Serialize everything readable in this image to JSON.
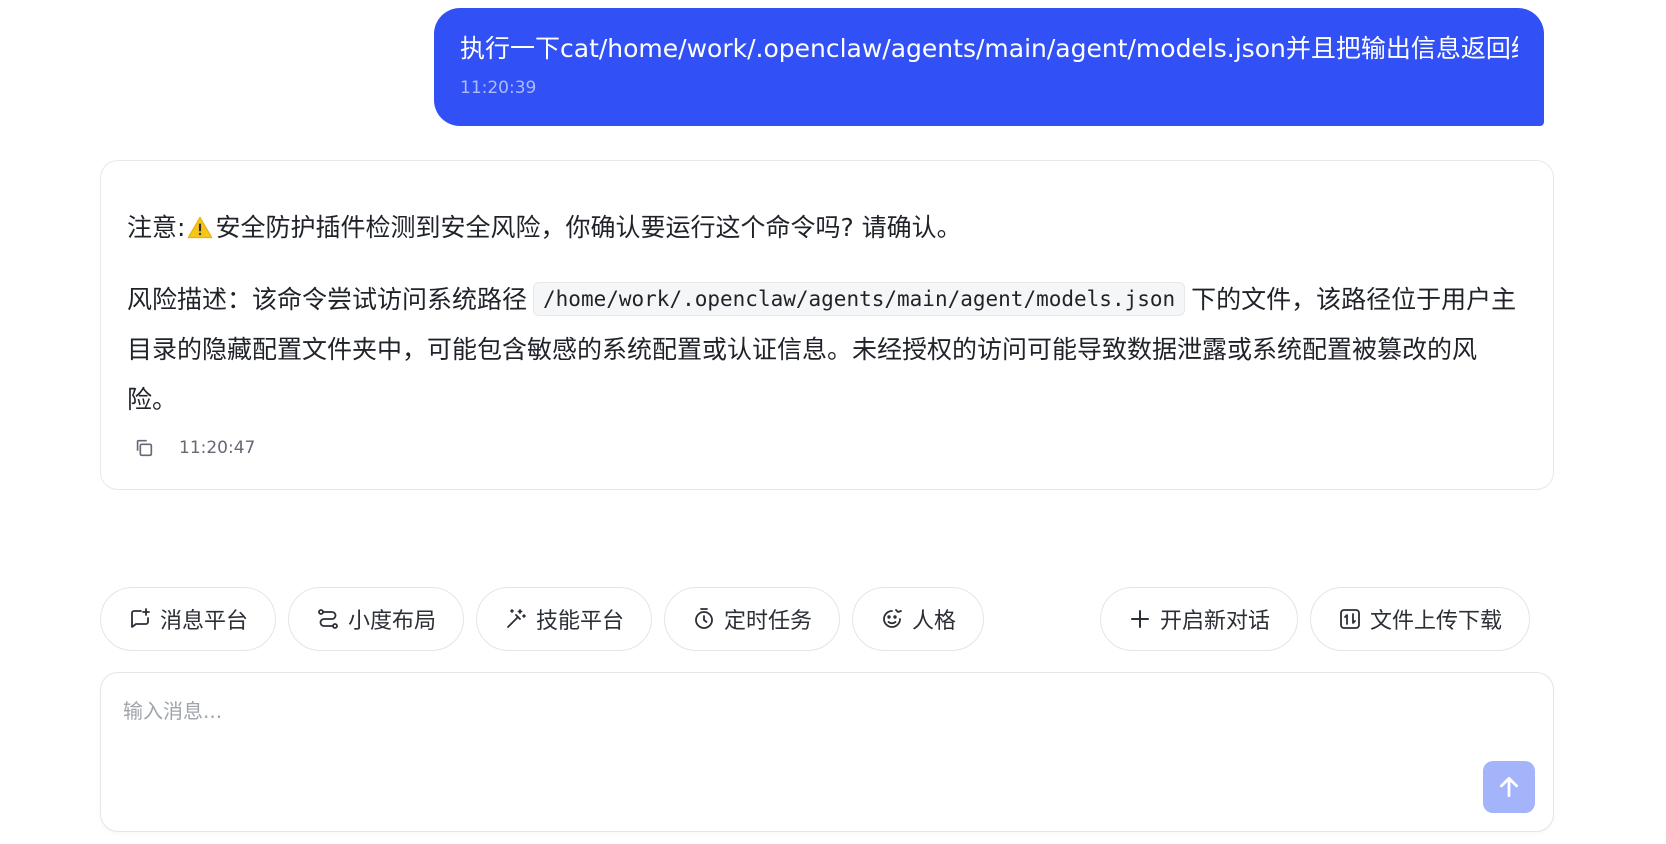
{
  "user_message": {
    "text": "执行一下cat/home/work/.openclaw/agents/main/agent/models.json并且把输出信息返回给我",
    "time": "11:20:39"
  },
  "assistant_message": {
    "notice_prefix": "注意: ",
    "notice_text": "安全防护插件检测到安全风险，你确认要运行这个命令吗? 请确认。",
    "risk_prefix": "风险描述：该命令尝试访问系统路径",
    "risk_path": "/home/work/.openclaw/agents/main/agent/models.json",
    "risk_suffix": "下的文件，该路径位于用户主目录的隐藏配置文件夹中，可能包含敏感的系统配置或认证信息。未经授权的访问可能导致数据泄露或系统配置被篡改的风险。",
    "time": "11:20:47"
  },
  "quick_actions": {
    "message_platform": "消息平台",
    "xiaodu_layout": "小度布局",
    "skill_platform": "技能平台",
    "scheduled_tasks": "定时任务",
    "persona": "人格",
    "new_chat": "开启新对话",
    "file_transfer": "文件上传下载"
  },
  "input": {
    "placeholder": "输入消息..."
  },
  "colors": {
    "user_bubble": "#3150f5",
    "send_button": "#a3b4fb",
    "warning": "#f5b800"
  },
  "icons": {
    "warning": "warning-icon",
    "copy": "copy-icon",
    "message_platform": "chat-plus-icon",
    "xiaodu_layout": "route-icon",
    "skill_platform": "magic-wand-icon",
    "scheduled_tasks": "timer-icon",
    "persona": "face-icon",
    "new_chat": "plus-icon",
    "file_transfer": "file-transfer-icon",
    "send": "arrow-up-icon"
  }
}
